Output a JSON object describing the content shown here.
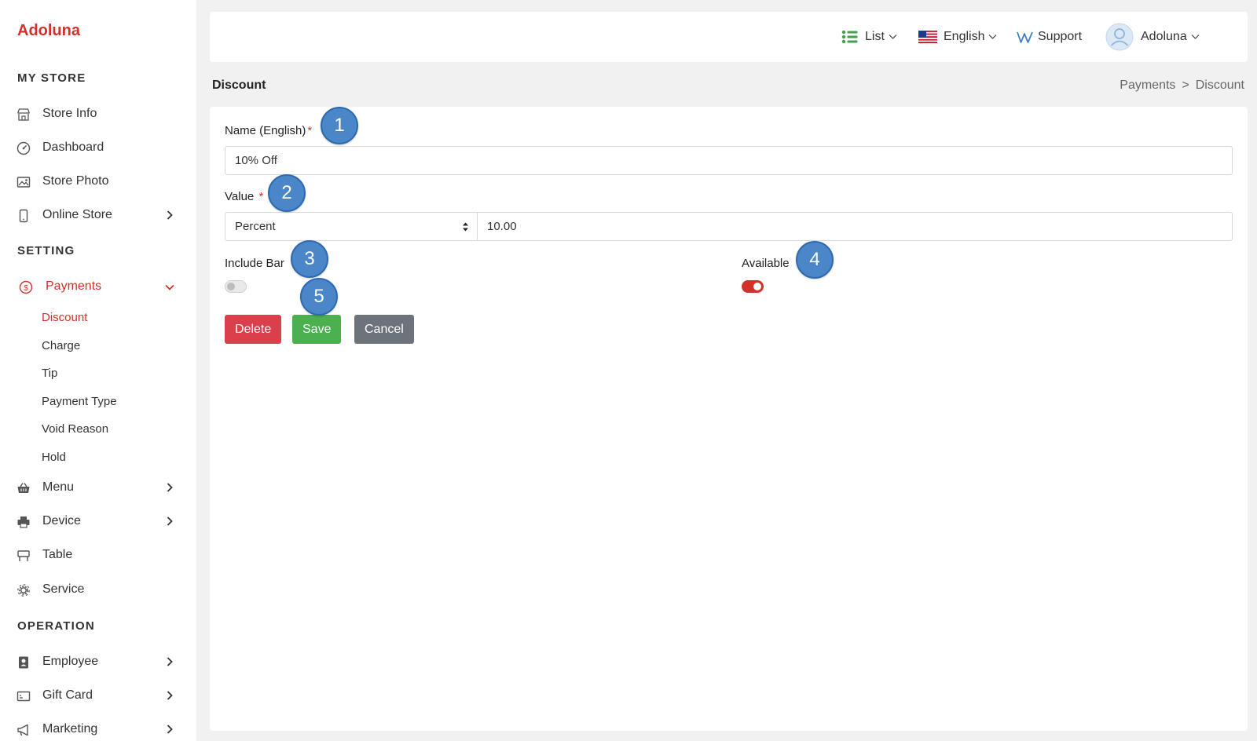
{
  "sidebar": {
    "brand": "Adoluna",
    "sections": {
      "my_store": "MY STORE",
      "setting": "SETTING",
      "operation": "OPERATION"
    },
    "items": {
      "store_info": "Store Info",
      "dashboard": "Dashboard",
      "store_photo": "Store Photo",
      "online_store": "Online Store",
      "payments": "Payments",
      "menu": "Menu",
      "device": "Device",
      "table": "Table",
      "service": "Service",
      "employee": "Employee",
      "gift_card": "Gift Card",
      "marketing": "Marketing"
    },
    "payments_sub": {
      "discount": "Discount",
      "charge": "Charge",
      "tip": "Tip",
      "payment_type": "Payment Type",
      "void_reason": "Void Reason",
      "hold": "Hold"
    },
    "accent_color": "#d0322a"
  },
  "topbar": {
    "list": "List",
    "language": "English",
    "support": "Support",
    "user": "Adoluna"
  },
  "page": {
    "title": "Discount",
    "breadcrumb": {
      "parent": "Payments",
      "separator": ">",
      "current": "Discount"
    }
  },
  "form": {
    "name_label": "Name (English)",
    "name_value": "10% Off",
    "value_label": "Value",
    "value_type": "Percent",
    "value_amount": "10.00",
    "required_mark": "*",
    "include_bar_label": "Include Bar",
    "include_bar_on": false,
    "available_label": "Available",
    "available_on": true
  },
  "buttons": {
    "delete": "Delete",
    "save": "Save",
    "cancel": "Cancel",
    "delete_color": "#d9404b",
    "save_color": "#4caf50",
    "cancel_color": "#6c737a"
  },
  "markers": [
    "1",
    "2",
    "3",
    "4",
    "5"
  ]
}
